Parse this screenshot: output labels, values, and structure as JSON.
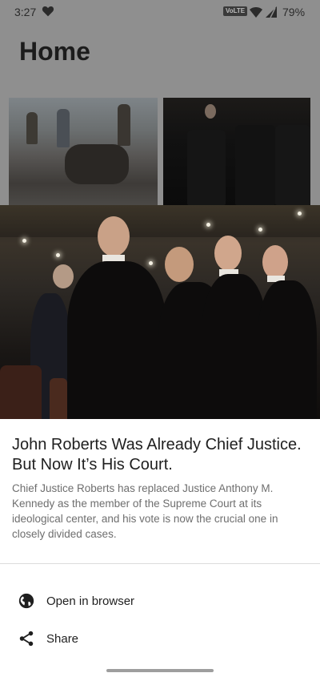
{
  "status_bar": {
    "time": "3:27",
    "network_badge": "VoLTE",
    "battery": "79%"
  },
  "app": {
    "title": "Home"
  },
  "article": {
    "headline": "John Roberts Was Already Chief Justice. But Now It’s His Court.",
    "summary": "Chief Justice Roberts has replaced Justice Anthony M. Kennedy as the member of the Supreme Court at its ideological center, and his vote is now the crucial one in closely divided cases."
  },
  "actions": {
    "open_in_browser": "Open in browser",
    "share": "Share"
  },
  "icons": {
    "status": [
      "heart-icon",
      "wifi-icon",
      "signal-icon"
    ],
    "actions": [
      "globe-icon",
      "share-icon"
    ]
  }
}
